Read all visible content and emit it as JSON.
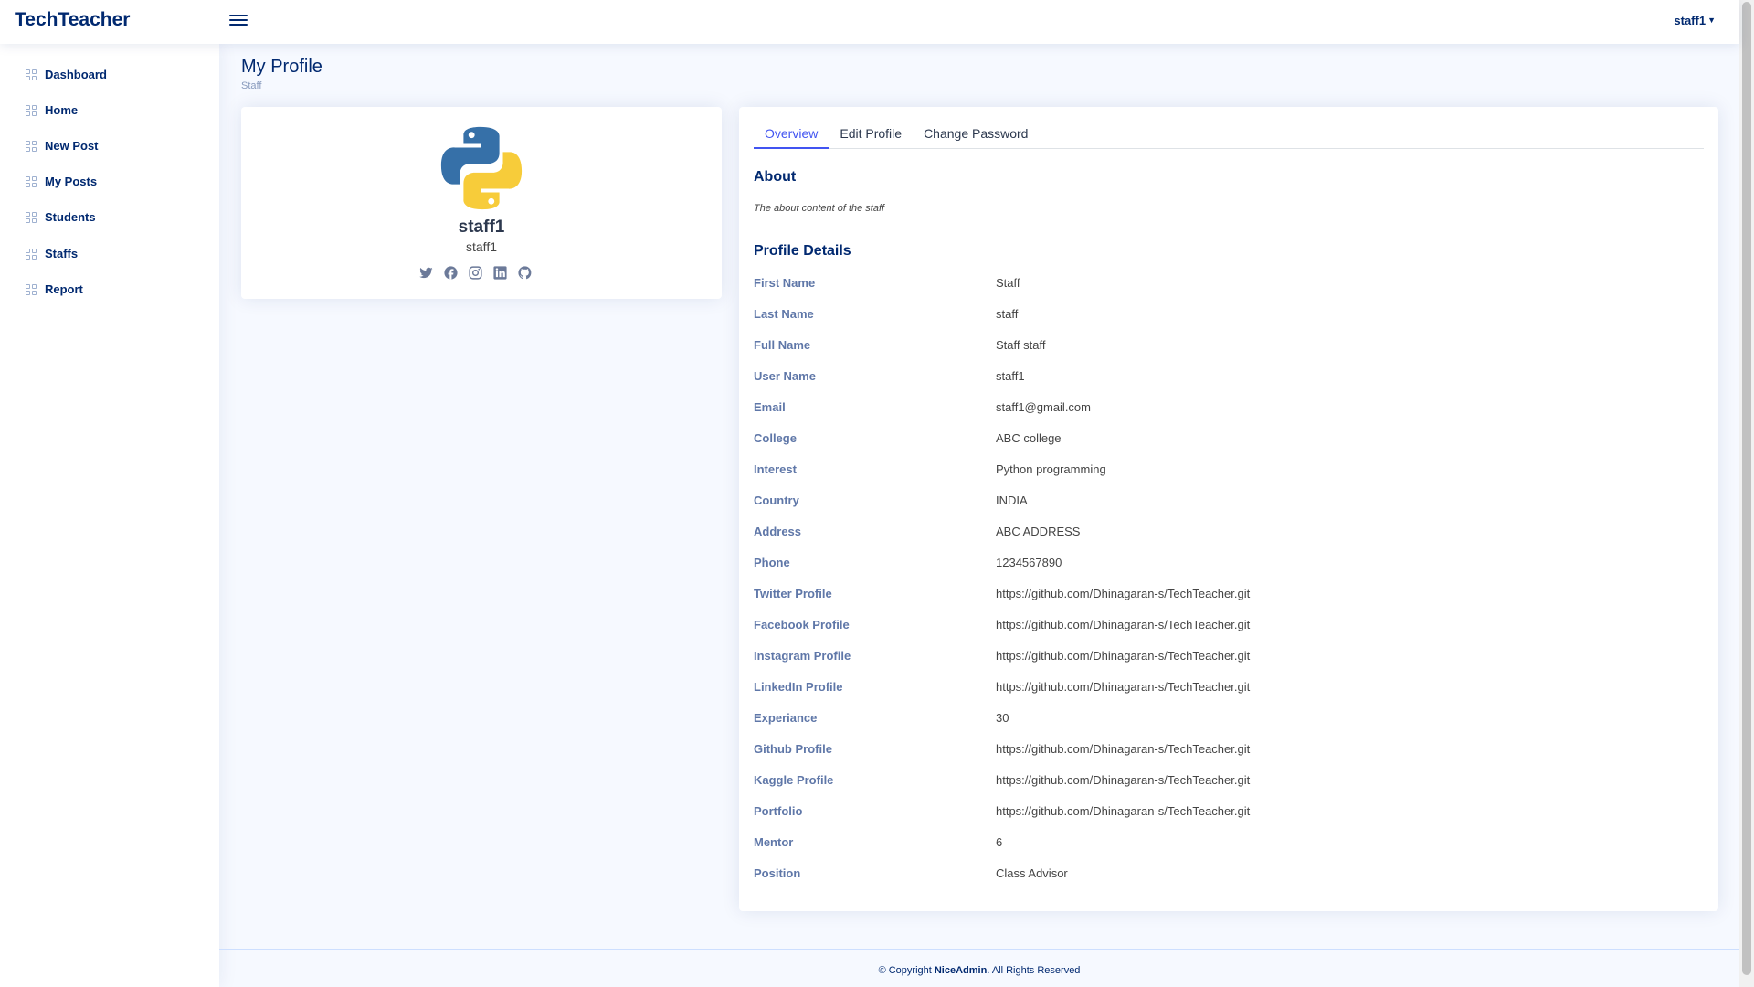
{
  "app": {
    "logo": "TechTeacher",
    "user": "staff1"
  },
  "sidebar": {
    "items": [
      {
        "label": "Dashboard"
      },
      {
        "label": "Home"
      },
      {
        "label": "New Post"
      },
      {
        "label": "My Posts"
      },
      {
        "label": "Students"
      },
      {
        "label": "Staffs"
      },
      {
        "label": "Report"
      }
    ]
  },
  "page": {
    "title": "My Profile",
    "breadcrumb": "Staff"
  },
  "profile": {
    "name": "staff1",
    "username": "staff1",
    "social_icons": [
      "twitter-icon",
      "facebook-icon",
      "instagram-icon",
      "linkedin-icon",
      "github-icon"
    ]
  },
  "tabs": [
    {
      "label": "Overview",
      "active": true
    },
    {
      "label": "Edit Profile",
      "active": false
    },
    {
      "label": "Change Password",
      "active": false
    }
  ],
  "about": {
    "title": "About",
    "text": "The about content of the staff"
  },
  "details": {
    "title": "Profile Details",
    "rows": [
      {
        "label": "First Name",
        "value": "Staff"
      },
      {
        "label": "Last Name",
        "value": "staff"
      },
      {
        "label": "Full Name",
        "value": "Staff staff"
      },
      {
        "label": "User Name",
        "value": "staff1"
      },
      {
        "label": "Email",
        "value": "staff1@gmail.com"
      },
      {
        "label": "College",
        "value": "ABC college"
      },
      {
        "label": "Interest",
        "value": "Python programming"
      },
      {
        "label": "Country",
        "value": "INDIA"
      },
      {
        "label": "Address",
        "value": "ABC ADDRESS"
      },
      {
        "label": "Phone",
        "value": "1234567890"
      },
      {
        "label": "Twitter Profile",
        "value": "https://github.com/Dhinagaran-s/TechTeacher.git"
      },
      {
        "label": "Facebook Profile",
        "value": "https://github.com/Dhinagaran-s/TechTeacher.git"
      },
      {
        "label": "Instagram Profile",
        "value": "https://github.com/Dhinagaran-s/TechTeacher.git"
      },
      {
        "label": "LinkedIn Profile",
        "value": "https://github.com/Dhinagaran-s/TechTeacher.git"
      },
      {
        "label": "Experiance",
        "value": "30"
      },
      {
        "label": "Github Profile",
        "value": "https://github.com/Dhinagaran-s/TechTeacher.git"
      },
      {
        "label": "Kaggle Profile",
        "value": "https://github.com/Dhinagaran-s/TechTeacher.git"
      },
      {
        "label": "Portfolio",
        "value": "https://github.com/Dhinagaran-s/TechTeacher.git"
      },
      {
        "label": "Mentor",
        "value": "6"
      },
      {
        "label": "Position",
        "value": "Class Advisor"
      }
    ]
  },
  "footer": {
    "prefix": "© Copyright ",
    "brand": "NiceAdmin",
    "suffix": ". All Rights Reserved"
  },
  "colors": {
    "primary": "#012970",
    "accent": "#4154f1",
    "label": "#5f77a8",
    "background": "#f6f9ff"
  }
}
